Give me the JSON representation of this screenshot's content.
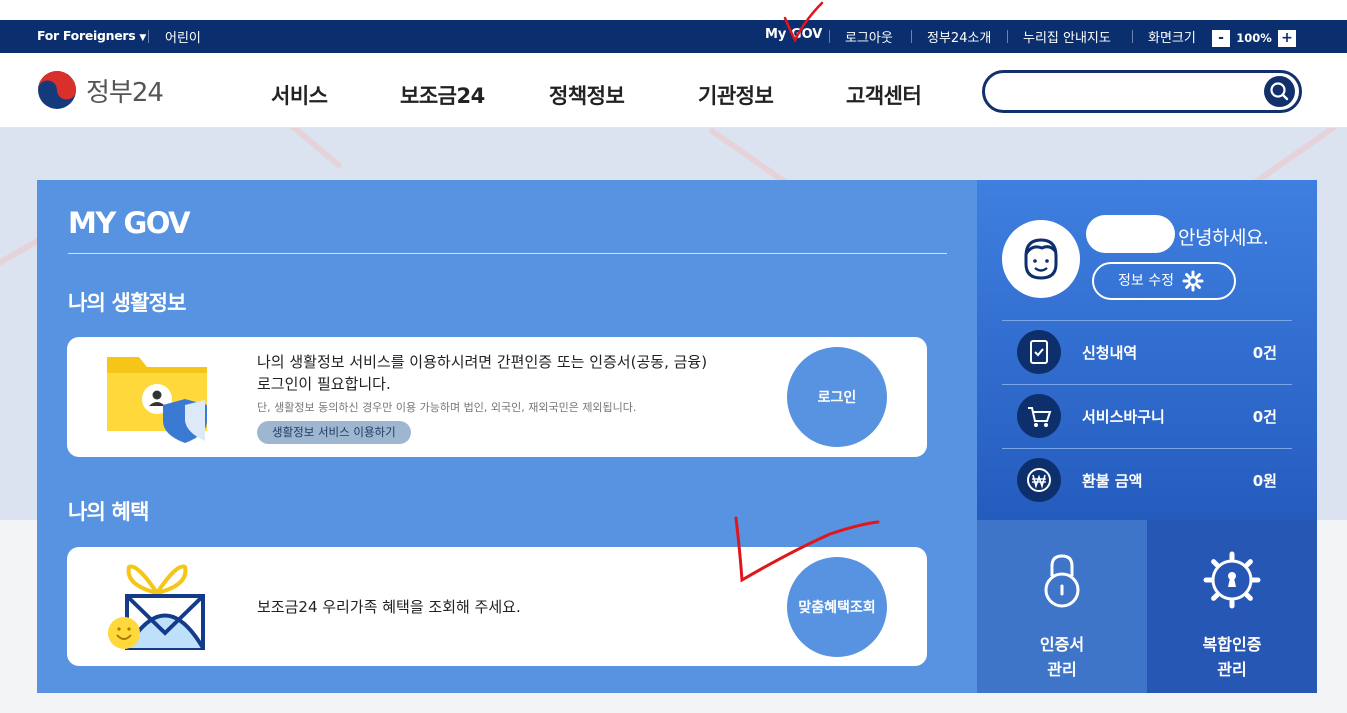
{
  "utility": {
    "foreigners": "For Foreigners",
    "kids": "어린이",
    "mygov": "My GOV",
    "logout": "로그아웃",
    "intro": "정부24소개",
    "sitemap": "누리집 안내지도",
    "zoom_label": "화면크기",
    "zoom_value": "100%",
    "zoom_minus": "-",
    "zoom_plus": "+"
  },
  "header": {
    "logo_text": "정부24",
    "nav": [
      "서비스",
      "보조금24",
      "정책정보",
      "기관정보",
      "고객센터"
    ],
    "search_placeholder": ""
  },
  "mygov": {
    "title": "MY GOV",
    "life": {
      "heading": "나의 생활정보",
      "message_line1": "나의 생활정보 서비스를 이용하시려면 간편인증 또는 인증서(공동, 금융)",
      "message_line2": "로그인이 필요합니다.",
      "note": "단, 생활정보 동의하신 경우만 이용 가능하며 법인, 외국인, 재외국민은 제외됩니다.",
      "pill": "생활정보 서비스 이용하기",
      "button": "로그인"
    },
    "benefit": {
      "heading": "나의 혜택",
      "message": "보조금24 우리가족 혜택을 조회해 주세요.",
      "button": "맞춤혜택조회"
    }
  },
  "profile": {
    "greeting": "안녕하세요.",
    "edit": "정보 수정",
    "stats": [
      {
        "label": "신청내역",
        "count": "0건"
      },
      {
        "label": "서비스바구니",
        "count": "0건"
      },
      {
        "label": "환불 금액",
        "count": "0원"
      }
    ],
    "tiles": [
      {
        "line1": "인증서",
        "line2": "관리"
      },
      {
        "line1": "복합인증",
        "line2": "관리"
      }
    ]
  },
  "colors": {
    "navy": "#0b2f6e",
    "panel_blue": "#5793e0",
    "annotation_red": "#e0161b"
  }
}
